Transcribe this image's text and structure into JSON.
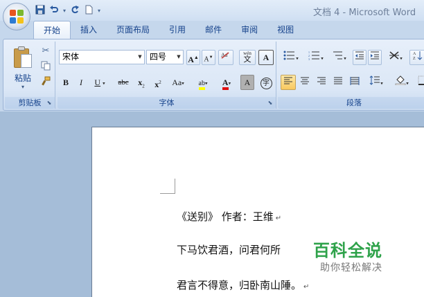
{
  "window": {
    "title": "文档 4 - Microsoft Word"
  },
  "quick_access": {
    "save_icon": "save-icon",
    "undo_icon": "undo-icon",
    "redo_icon": "redo-icon",
    "new_icon": "new-doc-icon",
    "customize": "▾"
  },
  "tabs": [
    {
      "label": "开始",
      "active": true
    },
    {
      "label": "插入",
      "active": false
    },
    {
      "label": "页面布局",
      "active": false
    },
    {
      "label": "引用",
      "active": false
    },
    {
      "label": "邮件",
      "active": false
    },
    {
      "label": "审阅",
      "active": false
    },
    {
      "label": "视图",
      "active": false
    }
  ],
  "ribbon": {
    "clipboard": {
      "group_label": "剪贴板",
      "paste_label": "粘贴"
    },
    "font": {
      "group_label": "字体",
      "font_name": "宋体",
      "font_size": "四号",
      "grow": "A",
      "shrink": "A",
      "bold": "B",
      "italic": "I",
      "underline": "U",
      "strike": "abc",
      "subscript": "x",
      "superscript": "x",
      "case": "Aa",
      "highlight": "ab",
      "color": "A",
      "shade": "A",
      "enclose": "字",
      "border_char": "A",
      "phonetic": "wén"
    },
    "paragraph": {
      "group_label": "段落"
    }
  },
  "colors": {
    "accent": "#15428b",
    "highlight_yellow": "#ffff00",
    "font_red": "#e01010",
    "watermark_green": "#2ea24a"
  },
  "document": {
    "lines": [
      "《送别》 作者：王维",
      "下马饮君酒，问君何所",
      "君言不得意，归卧南山陲。"
    ],
    "para_mark": "↵"
  },
  "watermark": {
    "main": "百科全说",
    "sub": "助你轻松解决"
  }
}
